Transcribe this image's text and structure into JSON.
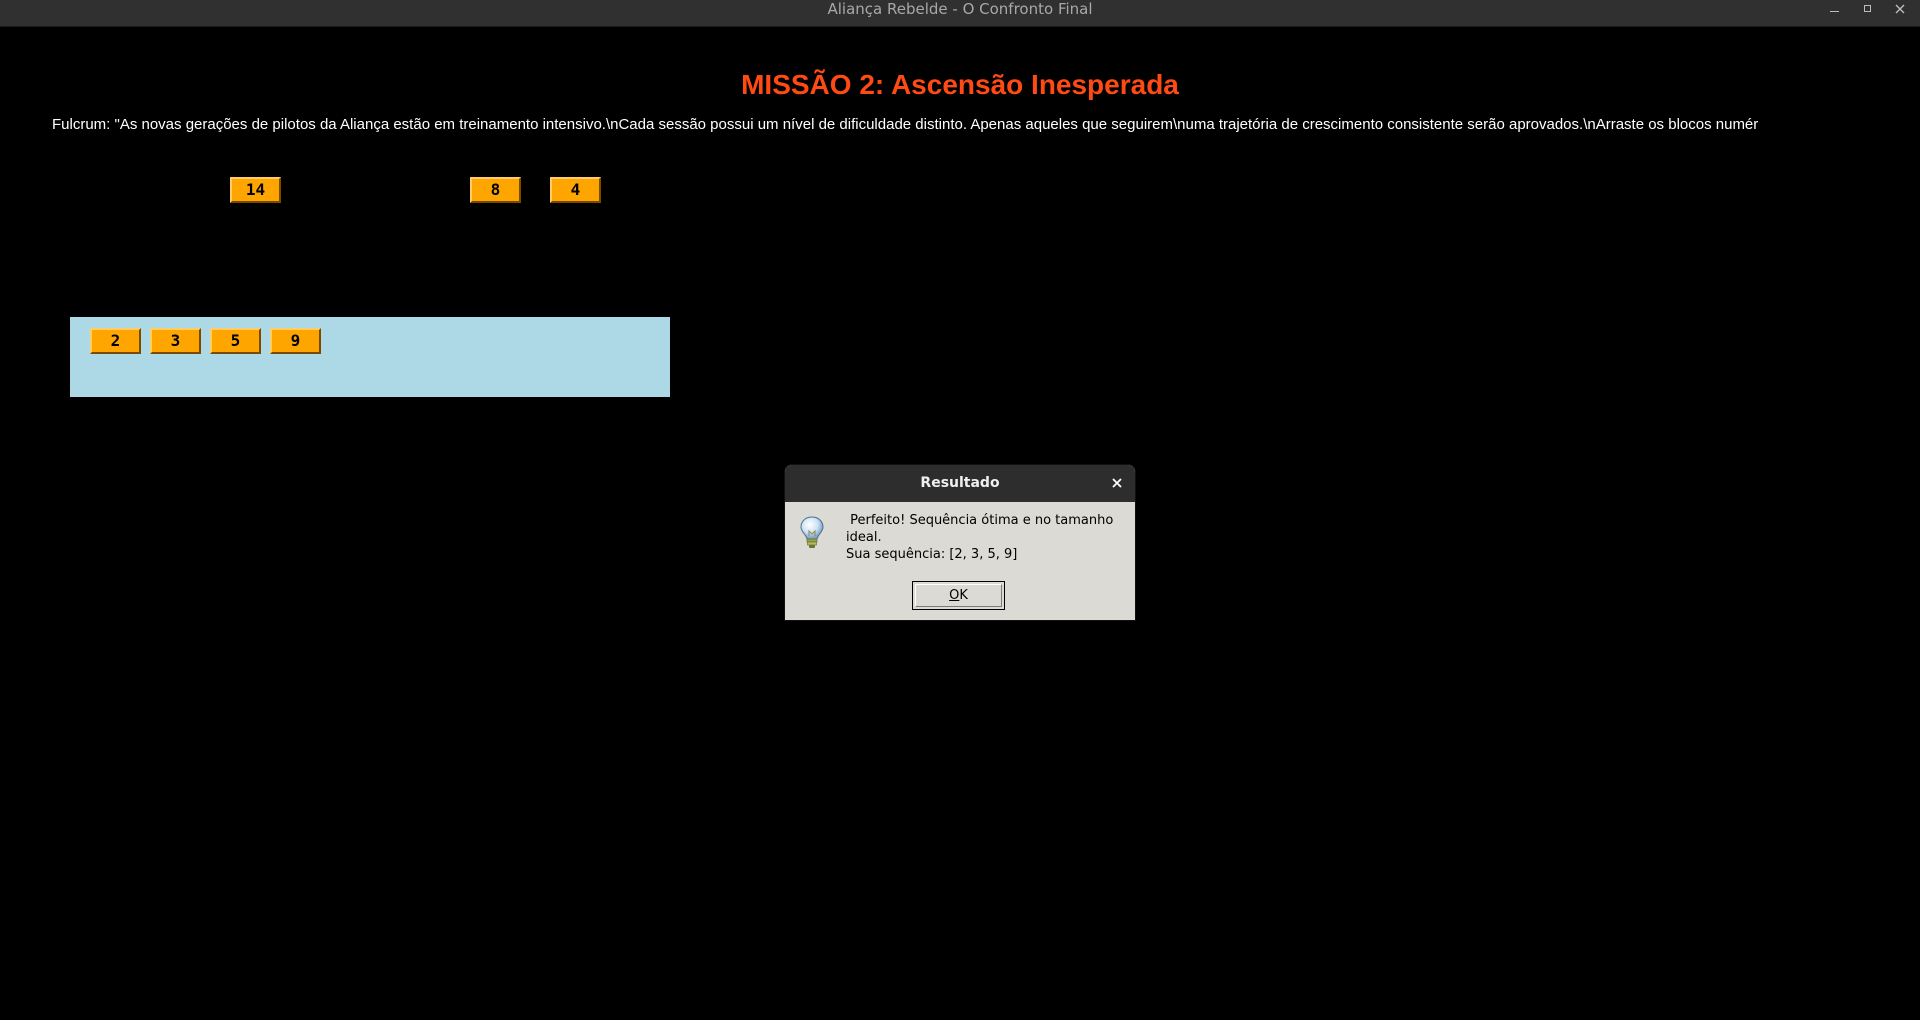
{
  "window": {
    "title": "Aliança Rebelde - O Confronto Final"
  },
  "mission": {
    "title": "MISSÃO 2: Ascensão Inesperada",
    "text": "Fulcrum: \"As novas gerações de pilotos da Aliança estão em treinamento intensivo.\\nCada sessão possui um nível de dificuldade distinto. Apenas aqueles que seguirem\\numa trajetória de crescimento consistente serão aprovados.\\nArraste os blocos numér"
  },
  "loose_blocks": [
    {
      "label": "14"
    },
    {
      "label": "8"
    },
    {
      "label": "4"
    }
  ],
  "sequence_blocks": [
    {
      "label": "2"
    },
    {
      "label": "3"
    },
    {
      "label": "5"
    },
    {
      "label": "9"
    }
  ],
  "dialog": {
    "title": "Resultado",
    "icon": "lightbulb-icon",
    "message_line1": " Perfeito! Sequência ótima e no tamanho ideal.",
    "message_line2": "Sua sequência: [2, 3, 5, 9]",
    "ok_mnemonic": "O",
    "ok_rest": "K"
  },
  "colors": {
    "background": "#000000",
    "title_accent": "#ff4a14",
    "block": "#ffa500",
    "drop_zone": "#add8e6",
    "dialog_bg": "#dcdad5"
  }
}
